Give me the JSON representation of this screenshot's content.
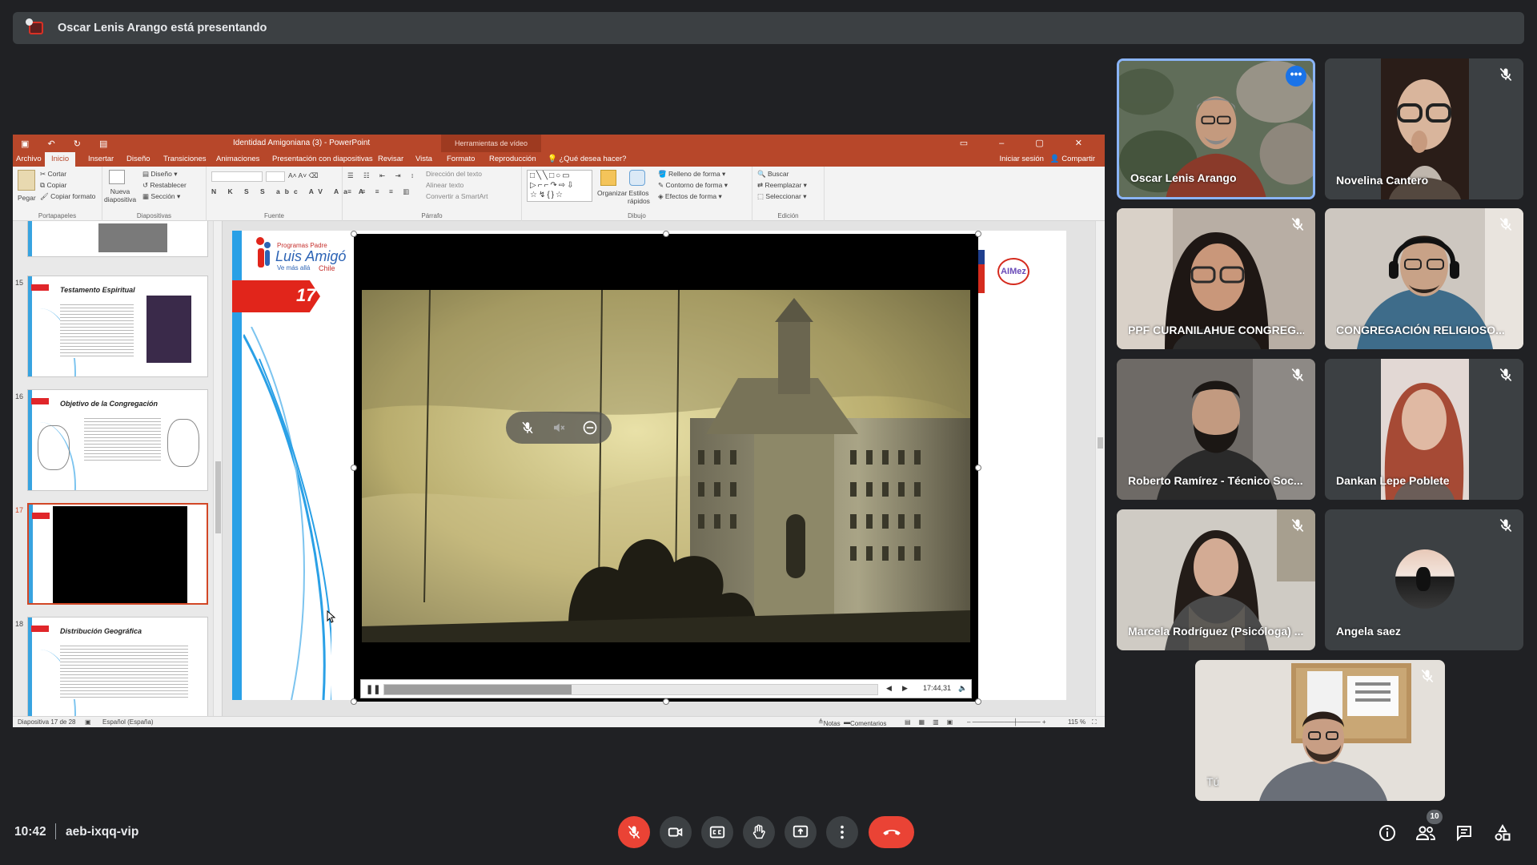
{
  "banner": {
    "text": "Oscar Lenis Arango está presentando"
  },
  "powerpoint": {
    "title": "Identidad Amigoniana (3) - PowerPoint",
    "context_tab": "Herramientas de vídeo",
    "tabs": [
      "Archivo",
      "Inicio",
      "Insertar",
      "Diseño",
      "Transiciones",
      "Animaciones",
      "Presentación con diapositivas",
      "Revisar",
      "Vista",
      "Formato",
      "Reproducción"
    ],
    "tell_me": "¿Qué desea hacer?",
    "sign_in": "Iniciar sesión",
    "share": "Compartir",
    "ribbon": {
      "clipboard": {
        "label": "Portapapeles",
        "paste": "Pegar",
        "cut": "Cortar",
        "copy": "Copiar",
        "format_painter": "Copiar formato"
      },
      "slides": {
        "label": "Diapositivas",
        "new_slide": "Nueva diapositiva",
        "layout": "Diseño",
        "reset": "Restablecer",
        "section": "Sección"
      },
      "font": {
        "label": "Fuente"
      },
      "paragraph": {
        "label": "Párrafo",
        "text_direction": "Dirección del texto",
        "align_text": "Alinear texto",
        "smartart": "Convertir a SmartArt"
      },
      "drawing": {
        "label": "Dibujo",
        "arrange": "Organizar",
        "quick_styles": "Estilos rápidos",
        "fill": "Relleno de forma",
        "outline": "Contorno de forma",
        "effects": "Efectos de forma"
      },
      "editing": {
        "label": "Edición",
        "find": "Buscar",
        "replace": "Reemplazar",
        "select": "Seleccionar"
      }
    },
    "thumbnails": [
      {
        "num": "15",
        "title": "Testamento Espiritual"
      },
      {
        "num": "16",
        "title": "Objetivo de la Congregación"
      },
      {
        "num": "17",
        "title": ""
      },
      {
        "num": "18",
        "title": "Distribución Geográfica"
      }
    ],
    "slide": {
      "number": "17",
      "logo_top": "Programas Padre",
      "logo_main": "Luis Amigó",
      "logo_sub": "Ve más allá",
      "logo_country": "Chile",
      "right_logo": "AIMez"
    },
    "video": {
      "time": "17:44,31",
      "progress": 0.38
    },
    "status": {
      "slide_info": "Diapositiva 17 de 28",
      "language": "Español (España)",
      "notes": "Notas",
      "comments": "Comentarios",
      "zoom": "115 %"
    }
  },
  "participants": [
    {
      "name": "Oscar Lenis Arango",
      "muted": false,
      "active": true
    },
    {
      "name": "Novelina Cantero",
      "muted": true
    },
    {
      "name": "PPF CURANILAHUE CONGREG...",
      "muted": true
    },
    {
      "name": "CONGREGACIÓN RELIGIOSO...",
      "muted": true
    },
    {
      "name": "Roberto Ramírez - Técnico Soc...",
      "muted": true
    },
    {
      "name": "Dankan Lepe Poblete",
      "muted": true
    },
    {
      "name": "Marcela Rodríguez (Psicóloga) ...",
      "muted": true
    },
    {
      "name": "Angela saez",
      "muted": true
    },
    {
      "name": "Tú",
      "muted": true
    }
  ],
  "meeting": {
    "time": "10:42",
    "code": "aeb-ixqq-vip",
    "participant_count": "10"
  }
}
